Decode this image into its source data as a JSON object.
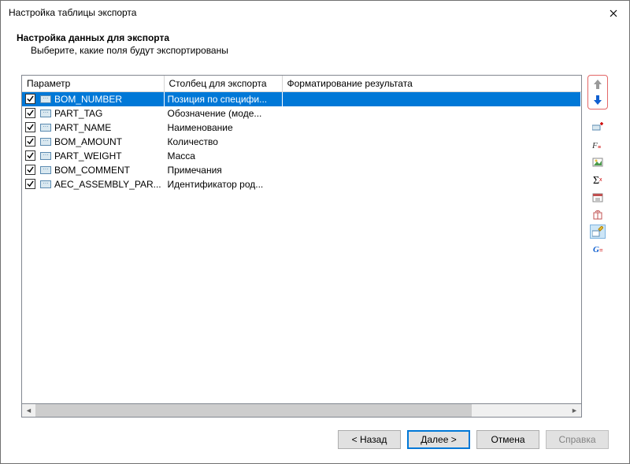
{
  "window": {
    "title": "Настройка таблицы экспорта"
  },
  "header": {
    "title": "Настройка данных для экспорта",
    "subtitle": "Выберите, какие поля будут экспортированы"
  },
  "columns": {
    "param": "Параметр",
    "export": "Столбец для экспорта",
    "format": "Форматирование результата"
  },
  "rows": [
    {
      "checked": true,
      "selected": true,
      "param": "BOM_NUMBER",
      "export": "Позиция по специфи...",
      "format": ""
    },
    {
      "checked": true,
      "selected": false,
      "param": "PART_TAG",
      "export": "Обозначение (моде...",
      "format": ""
    },
    {
      "checked": true,
      "selected": false,
      "param": "PART_NAME",
      "export": "Наименование",
      "format": ""
    },
    {
      "checked": true,
      "selected": false,
      "param": "BOM_AMOUNT",
      "export": "Количество",
      "format": ""
    },
    {
      "checked": true,
      "selected": false,
      "param": "PART_WEIGHT",
      "export": "Масса",
      "format": ""
    },
    {
      "checked": true,
      "selected": false,
      "param": "BOM_COMMENT",
      "export": "Примечания",
      "format": ""
    },
    {
      "checked": true,
      "selected": false,
      "param": "AEC_ASSEMBLY_PAR...",
      "export": "Идентификатор род...",
      "format": ""
    }
  ],
  "sidebar": {
    "move_up": "move-up",
    "move_down": "move-down",
    "tools": [
      {
        "name": "add-property-icon",
        "glyph": "plus-prop"
      },
      {
        "name": "formula-fx-icon",
        "glyph": "fx"
      },
      {
        "name": "picture-icon",
        "glyph": "image"
      },
      {
        "name": "sigma-icon",
        "glyph": "sigma"
      },
      {
        "name": "calendar-icon",
        "glyph": "calendar"
      },
      {
        "name": "group-gift-icon",
        "glyph": "gift"
      },
      {
        "name": "edit-cell-icon",
        "glyph": "edit",
        "highlight": true
      },
      {
        "name": "global-g-icon",
        "glyph": "g"
      }
    ]
  },
  "buttons": {
    "back": "< Назад",
    "next": "Далее >",
    "cancel": "Отмена",
    "help": "Справка"
  }
}
